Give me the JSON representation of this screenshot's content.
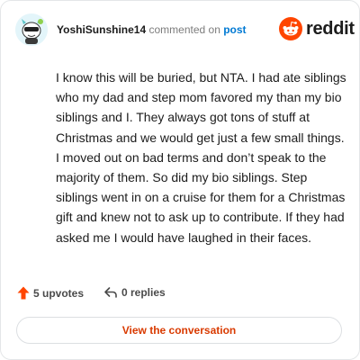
{
  "header": {
    "username": "YoshiSunshine14",
    "action_text": "commented on",
    "post_link": "post",
    "logo_text": "reddit"
  },
  "comment": {
    "text": "I know this will be buried, but NTA. I had ate siblings who my dad and step mom favored my than my bio siblings and I. They always got tons of stuff at Christmas and we would get just a few small things. I moved out on bad terms and don’t speak to the majority of them. So did my bio siblings. Step siblings went in on a cruise for them for a Christmas gift and knew not to ask up to contribute. If they had asked me I would have laughed in their faces."
  },
  "footer": {
    "upvotes_label": "5 upvotes",
    "replies_label": "0 replies",
    "view_button_label": "View the conversation"
  },
  "colors": {
    "accent": "#ff4500",
    "link": "#0079d3",
    "button_text": "#d93a00"
  },
  "icons": {
    "avatar": "snoo-avatar-icon",
    "logo": "reddit-snoo-icon",
    "upvote": "upvote-arrow-icon",
    "reply": "reply-arrow-icon"
  }
}
